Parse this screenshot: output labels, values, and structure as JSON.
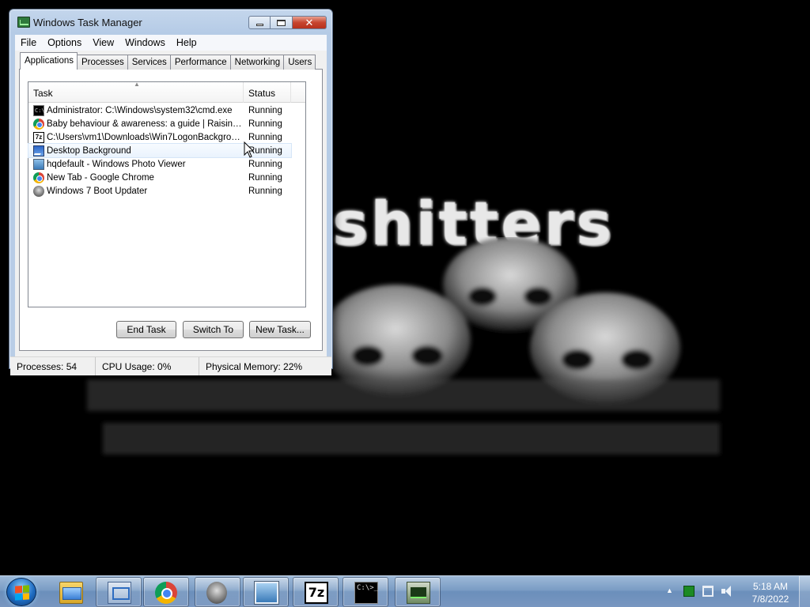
{
  "wallpaper": {
    "text": "shitters"
  },
  "window": {
    "title": "Windows Task Manager",
    "menu": [
      "File",
      "Options",
      "View",
      "Windows",
      "Help"
    ],
    "tabs": [
      "Applications",
      "Processes",
      "Services",
      "Performance",
      "Networking",
      "Users"
    ],
    "active_tab": "Applications",
    "columns": {
      "task": "Task",
      "status": "Status"
    },
    "tasks": [
      {
        "name": "Administrator: C:\\Windows\\system32\\cmd.exe",
        "status": "Running",
        "icon": "cmd-icon"
      },
      {
        "name": "Baby behaviour & awareness: a guide | Raising ...",
        "status": "Running",
        "icon": "chrome-icon"
      },
      {
        "name": "C:\\Users\\vm1\\Downloads\\Win7LogonBackgroun...",
        "status": "Running",
        "icon": "7zip-icon"
      },
      {
        "name": "Desktop Background",
        "status": "Running",
        "icon": "desktop-background-icon"
      },
      {
        "name": "hqdefault - Windows Photo Viewer",
        "status": "Running",
        "icon": "photo-viewer-icon"
      },
      {
        "name": "New Tab - Google Chrome",
        "status": "Running",
        "icon": "chrome-icon"
      },
      {
        "name": "Windows 7 Boot Updater",
        "status": "Running",
        "icon": "boot-updater-icon"
      }
    ],
    "buttons": {
      "end_task": "End Task",
      "switch_to": "Switch To",
      "new_task": "New Task..."
    },
    "status": {
      "processes": "Processes: 54",
      "cpu": "CPU Usage: 0%",
      "memory": "Physical Memory: 22%"
    }
  },
  "taskbar": {
    "items": [
      "explorer-icon",
      "task-manager-small-icon",
      "chrome-icon",
      "boot-updater-icon",
      "photo-viewer-icon",
      "7zip-icon",
      "cmd-icon",
      "task-manager-icon"
    ],
    "seven_zip_glyph": "7z",
    "cmd_glyph": "C:\\>_",
    "clock": {
      "time": "5:18 AM",
      "date": "7/8/2022"
    }
  }
}
